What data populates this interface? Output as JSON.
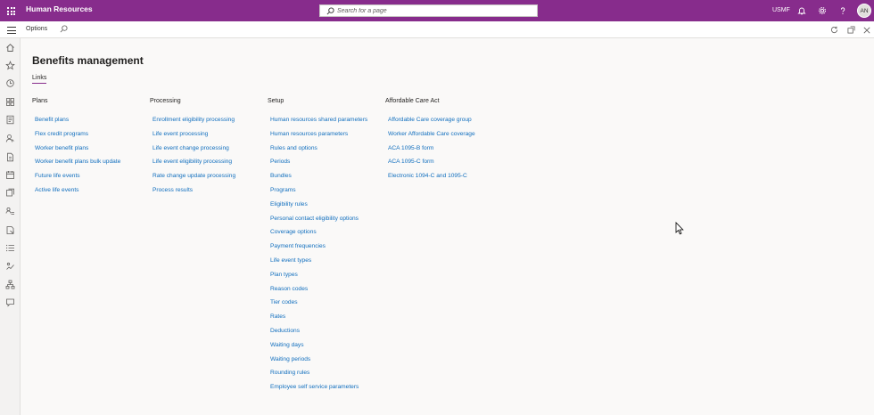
{
  "app": {
    "title": "Human Resources",
    "company": "USMF",
    "user_initials": "AN"
  },
  "search": {
    "placeholder": "Search for a page"
  },
  "actionbar": {
    "options_label": "Options"
  },
  "page": {
    "title": "Benefits management",
    "tab": "Links"
  },
  "columns": [
    {
      "heading": "Plans",
      "links": [
        "Benefit plans",
        "Flex credit programs",
        "Worker benefit plans",
        "Worker benefit plans bulk update",
        "Future life events",
        "Active life events"
      ]
    },
    {
      "heading": "Processing",
      "links": [
        "Enrollment eligibility processing",
        "Life event processing",
        "Life event change processing",
        "Life event eligibility processing",
        "Rate change update processing",
        "Process results"
      ]
    },
    {
      "heading": "Setup",
      "links": [
        "Human resources shared parameters",
        "Human resources parameters",
        "Rules and options",
        "Periods",
        "Bundles",
        "Programs",
        "Eligibility rules",
        "Personal contact eligibility options",
        "Coverage options",
        "Payment frequencies",
        "Life event types",
        "Plan types",
        "Reason codes",
        "Tier codes",
        "Rates",
        "Deductions",
        "Waiting days",
        "Waiting periods",
        "Rounding rules",
        "Employee self service parameters"
      ]
    },
    {
      "heading": "Affordable Care Act",
      "links": [
        "Affordable Care coverage group",
        "Worker Affordable Care coverage",
        "ACA 1095-B form",
        "ACA 1095-C form",
        "Electronic 1094-C and 1095-C"
      ]
    }
  ],
  "colors": {
    "brand": "#872c8c",
    "link": "#106ebe",
    "background": "#faf9f8"
  },
  "icons": {
    "topbar": [
      "waffle-icon",
      "search-icon",
      "bell-icon",
      "gear-icon",
      "help-icon"
    ],
    "actionbar": [
      "hamburger-icon",
      "search-icon",
      "refresh-icon",
      "open-in-new-window-icon",
      "close-icon"
    ],
    "navrail": [
      "home-icon",
      "star-icon",
      "recent-icon",
      "workspaces-icon",
      "modules-icon",
      "people-icon",
      "document-icon",
      "leave-icon",
      "benefits-icon",
      "compensation-icon",
      "performance-icon",
      "list-icon",
      "org-icon",
      "hierarchy-icon",
      "chat-icon"
    ]
  }
}
